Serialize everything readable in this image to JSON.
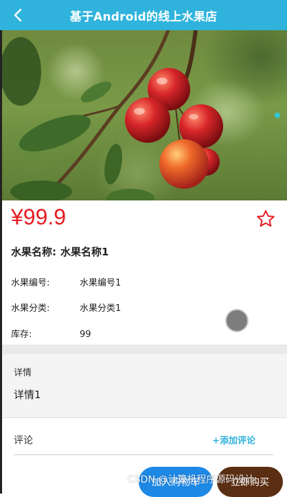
{
  "header": {
    "title": "基于Android的线上水果店"
  },
  "product": {
    "price": "¥99.9",
    "name_label": "水果名称:",
    "name_value": "水果名称1",
    "fields": [
      {
        "label": "水果编号:",
        "value": "水果编号1"
      },
      {
        "label": "水果分类:",
        "value": "水果分类1"
      },
      {
        "label": "库存:",
        "value": "99"
      }
    ]
  },
  "detail": {
    "title": "详情",
    "text": "详情1"
  },
  "comments": {
    "label": "评论",
    "add_label": "+添加评论"
  },
  "actions": {
    "cart_label": "加入购物车",
    "buy_label": "立即购买"
  },
  "watermark": "CSDN @计算机程序源码设计",
  "icons": {
    "back": "back-arrow-icon",
    "favorite": "star-outline-icon"
  },
  "colors": {
    "header": "#2fb3dc",
    "price": "#e51c23",
    "cart_button": "#1e88e5",
    "buy_button": "#5a2e12"
  }
}
